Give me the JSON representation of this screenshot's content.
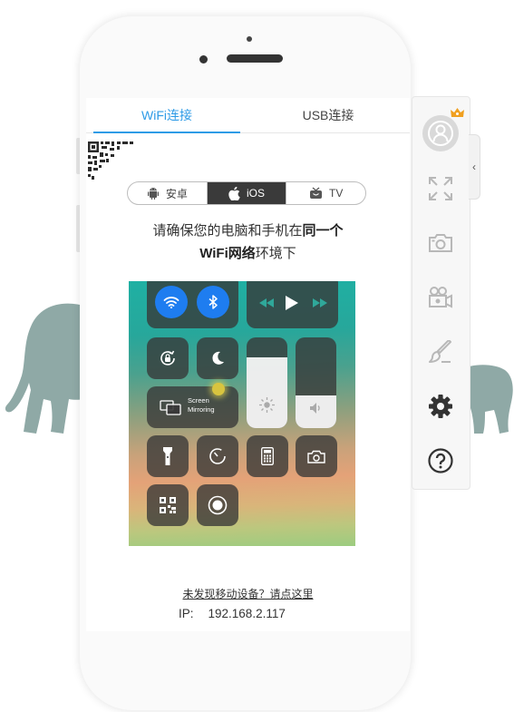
{
  "tabs": {
    "wifi": "WiFi连接",
    "usb": "USB连接"
  },
  "platforms": [
    {
      "label": "安卓",
      "icon": "android-icon"
    },
    {
      "label": "iOS",
      "icon": "apple-icon",
      "active": true
    },
    {
      "label": "TV",
      "icon": "tv-icon"
    }
  ],
  "instruction": {
    "line1_prefix": "请确保您的电脑和手机在",
    "line1_bold": "同一个",
    "line2_bold": "WiFi网络",
    "line2_suffix": "环境下"
  },
  "control_center": {
    "screen_mirroring_line1": "Screen",
    "screen_mirroring_line2": "Mirroring"
  },
  "help_link": "未发现移动设备？请点这里",
  "ip": {
    "label": "IP:",
    "value": "192.168.2.117"
  },
  "colors": {
    "accent": "#2e9be6",
    "elephant": "#8fa9a6"
  },
  "sidebar": {
    "icons": [
      "avatar-icon",
      "fullscreen-icon",
      "camera-icon",
      "video-camera-icon",
      "brush-icon",
      "gear-icon",
      "help-icon"
    ],
    "collapse": "‹"
  }
}
